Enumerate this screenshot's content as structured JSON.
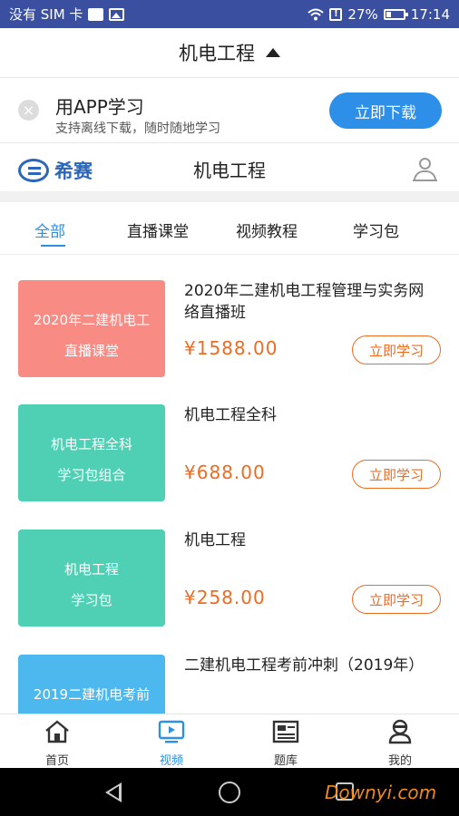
{
  "status_bar": {
    "carrier": "没有 SIM 卡",
    "battery": "27%",
    "time": "17:14"
  },
  "header": {
    "title": "机电工程"
  },
  "app_banner": {
    "title": "用APP学习",
    "subtitle": "支持离线下载，随时随地学习",
    "download_label": "立即下载"
  },
  "site": {
    "logo_text": "希赛",
    "title": "机电工程"
  },
  "tabs": [
    {
      "label": "全部"
    },
    {
      "label": "直播课堂"
    },
    {
      "label": "视频教程"
    },
    {
      "label": "学习包"
    }
  ],
  "courses": [
    {
      "thumb_line1": "2020年二建机电工",
      "thumb_line2": "直播课堂",
      "thumb_color": "#f98b85",
      "title": "2020年二建机电工程管理与实务网络直播班",
      "price": "¥1588.00",
      "button": "立即学习"
    },
    {
      "thumb_line1": "机电工程全科",
      "thumb_line2": "学习包组合",
      "thumb_color": "#4fcfb4",
      "title": "机电工程全科",
      "price": "¥688.00",
      "button": "立即学习"
    },
    {
      "thumb_line1": "机电工程",
      "thumb_line2": "学习包",
      "thumb_color": "#4fcfb4",
      "title": "机电工程",
      "price": "¥258.00",
      "button": "立即学习"
    },
    {
      "thumb_line1": "2019二建机电考前",
      "thumb_line2": "",
      "thumb_color": "#4db8ee",
      "title": "二建机电工程考前冲刺（2019年）",
      "price": "",
      "button": ""
    }
  ],
  "bottom_nav": [
    {
      "label": "首页",
      "icon": "home-icon"
    },
    {
      "label": "视频",
      "icon": "video-icon"
    },
    {
      "label": "题库",
      "icon": "question-bank-icon"
    },
    {
      "label": "我的",
      "icon": "profile-icon"
    }
  ],
  "watermark": "Downyi.com",
  "colors": {
    "accent": "#2e8fe8",
    "price": "#ee6b22",
    "statusbar": "#3a4fa0"
  }
}
